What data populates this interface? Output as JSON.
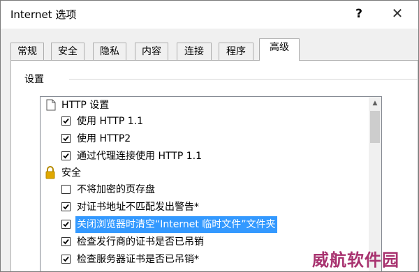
{
  "window": {
    "title": "Internet 选项",
    "help_label": "?",
    "close_label": "✕"
  },
  "tabs": [
    {
      "label": "常规"
    },
    {
      "label": "安全"
    },
    {
      "label": "隐私"
    },
    {
      "label": "内容"
    },
    {
      "label": "连接"
    },
    {
      "label": "程序"
    },
    {
      "label": "高级"
    }
  ],
  "active_tab": "高级",
  "settings": {
    "group_label": "设置",
    "items": [
      {
        "type": "category",
        "icon": "page-icon",
        "label": "HTTP 设置"
      },
      {
        "type": "checkbox",
        "checked": true,
        "label": "使用 HTTP 1.1"
      },
      {
        "type": "checkbox",
        "checked": true,
        "label": "使用 HTTP2"
      },
      {
        "type": "checkbox",
        "checked": true,
        "label": "通过代理连接使用 HTTP 1.1"
      },
      {
        "type": "category",
        "icon": "lock-icon",
        "label": "安全"
      },
      {
        "type": "checkbox",
        "checked": false,
        "label": "不将加密的页存盘"
      },
      {
        "type": "checkbox",
        "checked": true,
        "label": "对证书地址不匹配发出警告*"
      },
      {
        "type": "checkbox",
        "checked": true,
        "label": "关闭浏览器时清空“Internet 临时文件”文件夹",
        "selected": true
      },
      {
        "type": "checkbox",
        "checked": true,
        "label": "检查发行商的证书是否已吊销"
      },
      {
        "type": "checkbox",
        "checked": true,
        "label": "检查服务器证书是否已吊销*"
      }
    ]
  },
  "watermark": "威航软件园",
  "colors": {
    "selection": "#3399ff",
    "watermark": "#a8326f",
    "lock": "#e0a800"
  }
}
